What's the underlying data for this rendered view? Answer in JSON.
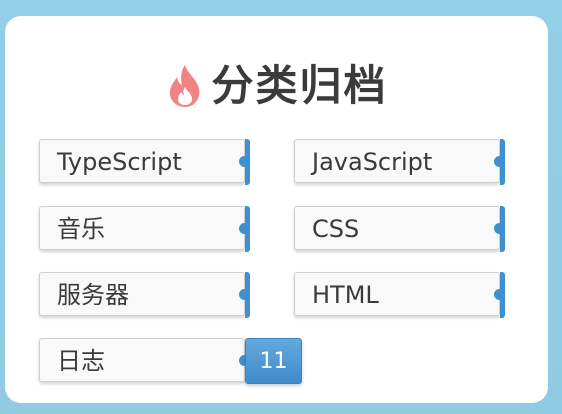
{
  "page": {
    "title": "分类归档",
    "title_icon": "fire-icon",
    "accent_color": "#3f90cf",
    "icon_color": "#f28384",
    "background_color": "#93cfe6"
  },
  "categories": [
    {
      "name": "TypeScript",
      "count": ""
    },
    {
      "name": "JavaScript",
      "count": ""
    },
    {
      "name": "音乐",
      "count": ""
    },
    {
      "name": "CSS",
      "count": ""
    },
    {
      "name": "服务器",
      "count": ""
    },
    {
      "name": "HTML",
      "count": ""
    },
    {
      "name": "日志",
      "count": "11"
    }
  ]
}
